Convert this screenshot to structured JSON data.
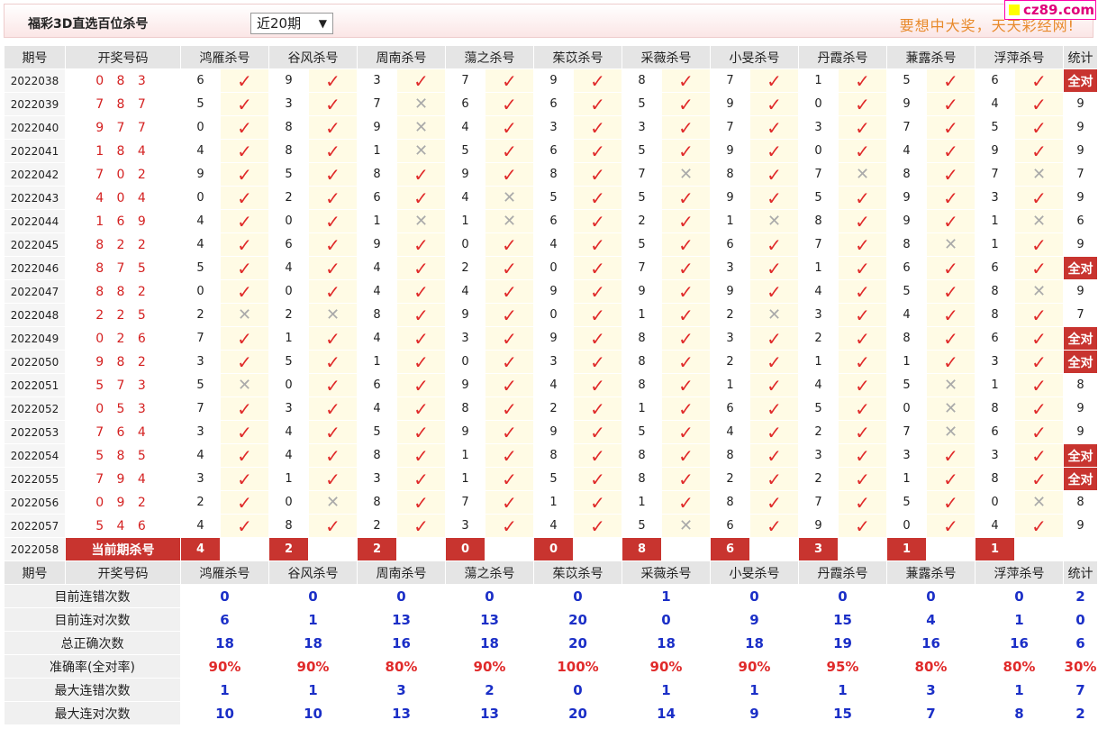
{
  "header": {
    "title": "福彩3D直选百位杀号",
    "period_select": "近20期",
    "slogan": "要想中大奖，天天彩经网!",
    "logo_text": "cz89.com"
  },
  "columns": {
    "period": "期号",
    "draw": "开奖号码",
    "experts": [
      "鸿雁杀号",
      "谷风杀号",
      "周南杀号",
      "蕩之杀号",
      "茱苡杀号",
      "采薇杀号",
      "小旻杀号",
      "丹霞杀号",
      "蒹露杀号",
      "浮萍杀号"
    ],
    "stat": "统计"
  },
  "rows": [
    {
      "period": "2022038",
      "draw": "0 8 3",
      "kills": [
        "6",
        "9",
        "3",
        "7",
        "9",
        "8",
        "7",
        "1",
        "5",
        "6"
      ],
      "ok": [
        1,
        1,
        1,
        1,
        1,
        1,
        1,
        1,
        1,
        1
      ],
      "stat": "全对"
    },
    {
      "period": "2022039",
      "draw": "7 8 7",
      "kills": [
        "5",
        "3",
        "7",
        "6",
        "6",
        "5",
        "9",
        "0",
        "9",
        "4"
      ],
      "ok": [
        1,
        1,
        0,
        1,
        1,
        1,
        1,
        1,
        1,
        1
      ],
      "stat": "9"
    },
    {
      "period": "2022040",
      "draw": "9 7 7",
      "kills": [
        "0",
        "8",
        "9",
        "4",
        "3",
        "3",
        "7",
        "3",
        "7",
        "5"
      ],
      "ok": [
        1,
        1,
        0,
        1,
        1,
        1,
        1,
        1,
        1,
        1
      ],
      "stat": "9"
    },
    {
      "period": "2022041",
      "draw": "1 8 4",
      "kills": [
        "4",
        "8",
        "1",
        "5",
        "6",
        "5",
        "9",
        "0",
        "4",
        "9"
      ],
      "ok": [
        1,
        1,
        0,
        1,
        1,
        1,
        1,
        1,
        1,
        1
      ],
      "stat": "9"
    },
    {
      "period": "2022042",
      "draw": "7 0 2",
      "kills": [
        "9",
        "5",
        "8",
        "9",
        "8",
        "7",
        "8",
        "7",
        "8",
        "7"
      ],
      "ok": [
        1,
        1,
        1,
        1,
        1,
        0,
        1,
        0,
        1,
        0
      ],
      "stat": "7"
    },
    {
      "period": "2022043",
      "draw": "4 0 4",
      "kills": [
        "0",
        "2",
        "6",
        "4",
        "5",
        "5",
        "9",
        "5",
        "9",
        "3"
      ],
      "ok": [
        1,
        1,
        1,
        0,
        1,
        1,
        1,
        1,
        1,
        1
      ],
      "stat": "9"
    },
    {
      "period": "2022044",
      "draw": "1 6 9",
      "kills": [
        "4",
        "0",
        "1",
        "1",
        "6",
        "2",
        "1",
        "8",
        "9",
        "1"
      ],
      "ok": [
        1,
        1,
        0,
        0,
        1,
        1,
        0,
        1,
        1,
        0
      ],
      "stat": "6"
    },
    {
      "period": "2022045",
      "draw": "8 2 2",
      "kills": [
        "4",
        "6",
        "9",
        "0",
        "4",
        "5",
        "6",
        "7",
        "8",
        "1"
      ],
      "ok": [
        1,
        1,
        1,
        1,
        1,
        1,
        1,
        1,
        0,
        1
      ],
      "stat": "9"
    },
    {
      "period": "2022046",
      "draw": "8 7 5",
      "kills": [
        "5",
        "4",
        "4",
        "2",
        "0",
        "7",
        "3",
        "1",
        "6",
        "6"
      ],
      "ok": [
        1,
        1,
        1,
        1,
        1,
        1,
        1,
        1,
        1,
        1
      ],
      "stat": "全对"
    },
    {
      "period": "2022047",
      "draw": "8 8 2",
      "kills": [
        "0",
        "0",
        "4",
        "4",
        "9",
        "9",
        "9",
        "4",
        "5",
        "8"
      ],
      "ok": [
        1,
        1,
        1,
        1,
        1,
        1,
        1,
        1,
        1,
        0
      ],
      "stat": "9"
    },
    {
      "period": "2022048",
      "draw": "2 2 5",
      "kills": [
        "2",
        "2",
        "8",
        "9",
        "0",
        "1",
        "2",
        "3",
        "4",
        "8"
      ],
      "ok": [
        0,
        0,
        1,
        1,
        1,
        1,
        0,
        1,
        1,
        1
      ],
      "stat": "7"
    },
    {
      "period": "2022049",
      "draw": "0 2 6",
      "kills": [
        "7",
        "1",
        "4",
        "3",
        "9",
        "8",
        "3",
        "2",
        "8",
        "6"
      ],
      "ok": [
        1,
        1,
        1,
        1,
        1,
        1,
        1,
        1,
        1,
        1
      ],
      "stat": "全对"
    },
    {
      "period": "2022050",
      "draw": "9 8 2",
      "kills": [
        "3",
        "5",
        "1",
        "0",
        "3",
        "8",
        "2",
        "1",
        "1",
        "3"
      ],
      "ok": [
        1,
        1,
        1,
        1,
        1,
        1,
        1,
        1,
        1,
        1
      ],
      "stat": "全对"
    },
    {
      "period": "2022051",
      "draw": "5 7 3",
      "kills": [
        "5",
        "0",
        "6",
        "9",
        "4",
        "8",
        "1",
        "4",
        "5",
        "1"
      ],
      "ok": [
        0,
        1,
        1,
        1,
        1,
        1,
        1,
        1,
        0,
        1
      ],
      "stat": "8"
    },
    {
      "period": "2022052",
      "draw": "0 5 3",
      "kills": [
        "7",
        "3",
        "4",
        "8",
        "2",
        "1",
        "6",
        "5",
        "0",
        "8"
      ],
      "ok": [
        1,
        1,
        1,
        1,
        1,
        1,
        1,
        1,
        0,
        1
      ],
      "stat": "9"
    },
    {
      "period": "2022053",
      "draw": "7 6 4",
      "kills": [
        "3",
        "4",
        "5",
        "9",
        "9",
        "5",
        "4",
        "2",
        "7",
        "6"
      ],
      "ok": [
        1,
        1,
        1,
        1,
        1,
        1,
        1,
        1,
        0,
        1
      ],
      "stat": "9"
    },
    {
      "period": "2022054",
      "draw": "5 8 5",
      "kills": [
        "4",
        "4",
        "8",
        "1",
        "8",
        "8",
        "8",
        "3",
        "3",
        "3"
      ],
      "ok": [
        1,
        1,
        1,
        1,
        1,
        1,
        1,
        1,
        1,
        1
      ],
      "stat": "全对"
    },
    {
      "period": "2022055",
      "draw": "7 9 4",
      "kills": [
        "3",
        "1",
        "3",
        "1",
        "5",
        "8",
        "2",
        "2",
        "1",
        "8"
      ],
      "ok": [
        1,
        1,
        1,
        1,
        1,
        1,
        1,
        1,
        1,
        1
      ],
      "stat": "全对"
    },
    {
      "period": "2022056",
      "draw": "0 9 2",
      "kills": [
        "2",
        "0",
        "8",
        "7",
        "1",
        "1",
        "8",
        "7",
        "5",
        "0"
      ],
      "ok": [
        1,
        0,
        1,
        1,
        1,
        1,
        1,
        1,
        1,
        0
      ],
      "stat": "8"
    },
    {
      "period": "2022057",
      "draw": "5 4 6",
      "kills": [
        "4",
        "8",
        "2",
        "3",
        "4",
        "5",
        "6",
        "9",
        "0",
        "4"
      ],
      "ok": [
        1,
        1,
        1,
        1,
        1,
        0,
        1,
        1,
        1,
        1
      ],
      "stat": "9"
    }
  ],
  "current": {
    "period": "2022058",
    "label": "当前期杀号",
    "kills": [
      "4",
      "2",
      "2",
      "0",
      "0",
      "8",
      "6",
      "3",
      "1",
      "1"
    ]
  },
  "symbols": {
    "ok": "✓",
    "bad": "✕"
  },
  "stats": [
    {
      "label": "目前连错次数",
      "values": [
        "0",
        "0",
        "0",
        "0",
        "0",
        "1",
        "0",
        "0",
        "0",
        "0"
      ],
      "total": "2",
      "color": "blue"
    },
    {
      "label": "目前连对次数",
      "values": [
        "6",
        "1",
        "13",
        "13",
        "20",
        "0",
        "9",
        "15",
        "4",
        "1"
      ],
      "total": "0",
      "color": "blue"
    },
    {
      "label": "总正确次数",
      "values": [
        "18",
        "18",
        "16",
        "18",
        "20",
        "18",
        "18",
        "19",
        "16",
        "16"
      ],
      "total": "6",
      "color": "blue"
    },
    {
      "label": "准确率(全对率)",
      "values": [
        "90%",
        "90%",
        "80%",
        "90%",
        "100%",
        "90%",
        "90%",
        "95%",
        "80%",
        "80%"
      ],
      "total": "30%",
      "color": "red"
    },
    {
      "label": "最大连错次数",
      "values": [
        "1",
        "1",
        "3",
        "2",
        "0",
        "1",
        "1",
        "1",
        "3",
        "1"
      ],
      "total": "7",
      "color": "blue"
    },
    {
      "label": "最大连对次数",
      "values": [
        "10",
        "10",
        "13",
        "13",
        "20",
        "14",
        "9",
        "15",
        "7",
        "8"
      ],
      "total": "2",
      "color": "blue"
    }
  ],
  "colors": {
    "accent_red": "#c8342f",
    "tick_red": "#e02a2a",
    "stat_blue": "#1b2fc7",
    "slogan_orange": "#e88a2c"
  }
}
